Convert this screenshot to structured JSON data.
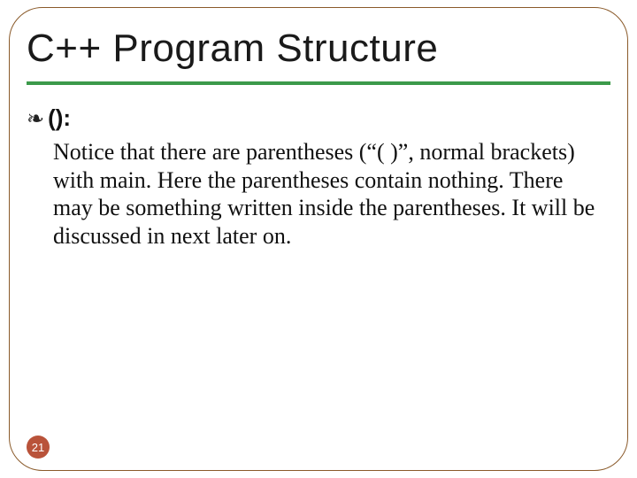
{
  "slide": {
    "title": "C++ Program Structure",
    "bullet_icon": "❧",
    "bullet_label": "():",
    "body": "Notice that there are parentheses (“( )”, normal brackets) with main. Here the parentheses contain nothing. There may be something written inside the parentheses. It will be discussed in next later on.",
    "page_number": "21"
  }
}
